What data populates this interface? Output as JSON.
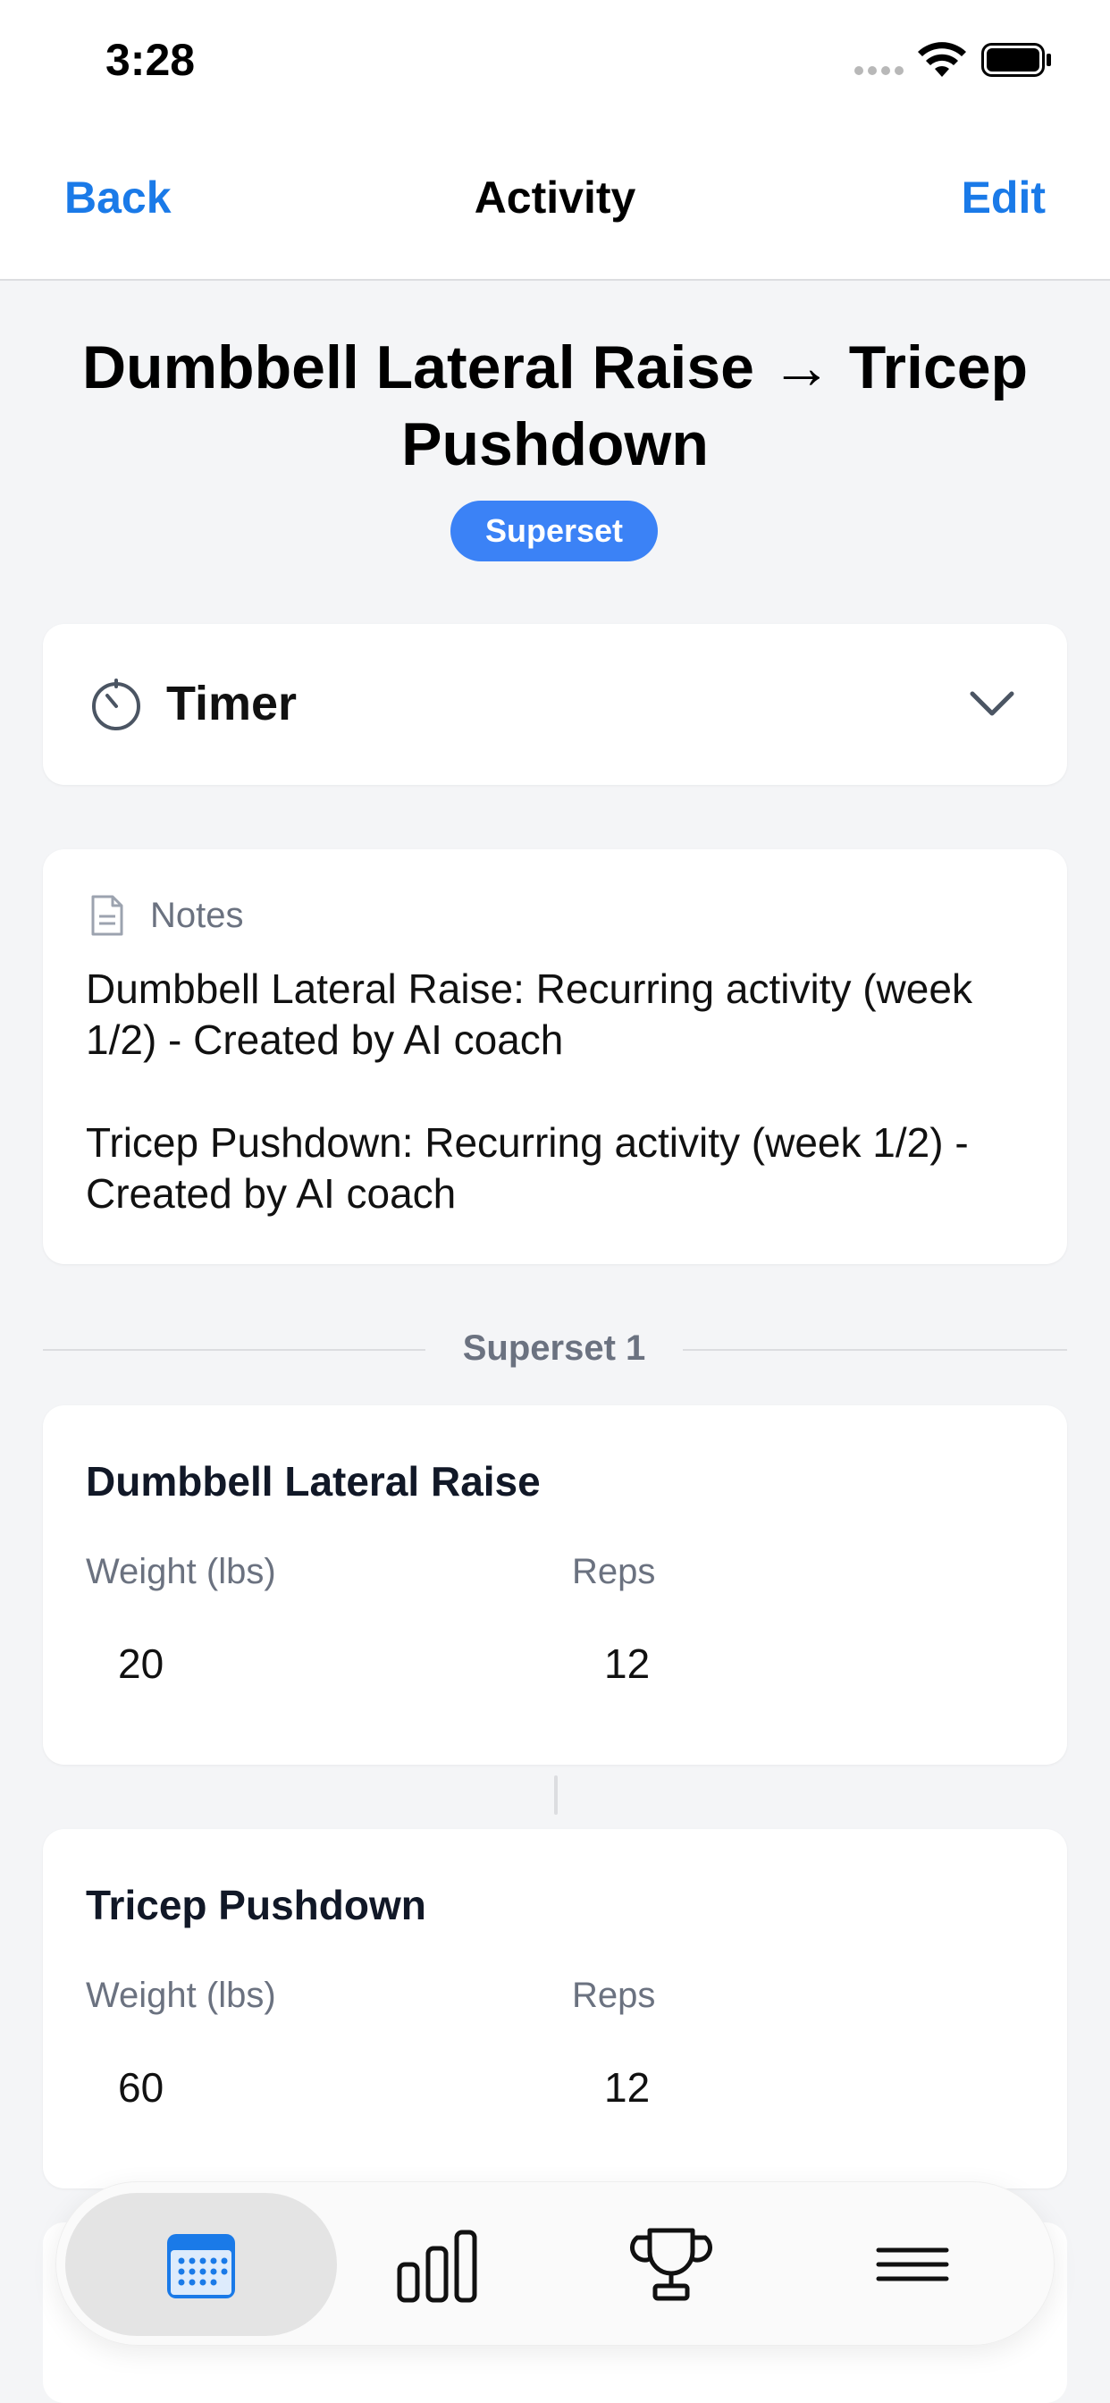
{
  "status_bar": {
    "time": "3:28"
  },
  "nav": {
    "back_label": "Back",
    "title": "Activity",
    "edit_label": "Edit"
  },
  "activity": {
    "title": "Dumbbell Lateral Raise → Tricep Pushdown",
    "badge": "Superset"
  },
  "timer": {
    "label": "Timer",
    "icon": "stopwatch-icon",
    "expand_icon": "chevron-down-icon"
  },
  "notes": {
    "label": "Notes",
    "icon": "document-icon",
    "paragraphs": [
      "Dumbbell Lateral Raise: Recurring activity (week 1/2) - Created by AI coach",
      "Tricep Pushdown: Recurring activity (week 1/2) - Created by AI coach"
    ]
  },
  "superset_group": {
    "label": "Superset 1"
  },
  "exercises": [
    {
      "name": "Dumbbell Lateral Raise",
      "weight_label": "Weight (lbs)",
      "reps_label": "Reps",
      "weight": "20",
      "reps": "12"
    },
    {
      "name": "Tricep Pushdown",
      "weight_label": "Weight (lbs)",
      "reps_label": "Reps",
      "weight": "60",
      "reps": "12"
    }
  ],
  "tab_bar": {
    "items": [
      {
        "icon": "calendar-icon",
        "active": true
      },
      {
        "icon": "bar-chart-icon",
        "active": false
      },
      {
        "icon": "trophy-icon",
        "active": false
      },
      {
        "icon": "menu-icon",
        "active": false
      }
    ]
  },
  "colors": {
    "accent": "#1a7ae8",
    "badge": "#3b82f6",
    "secondary_text": "#6b7280",
    "background": "#f4f5f7"
  }
}
